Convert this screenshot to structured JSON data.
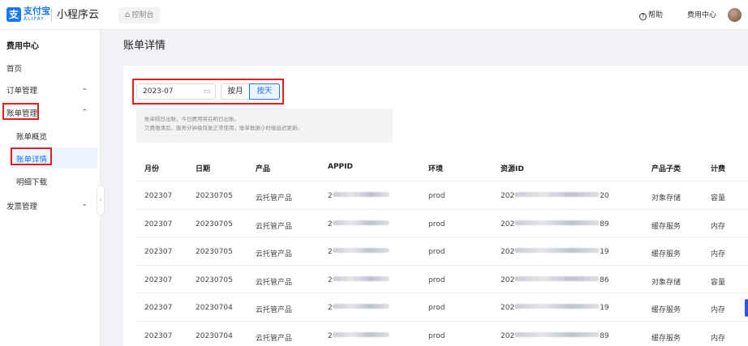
{
  "topbar": {
    "logo_main": "支付宝",
    "logo_sub": "ALIPAY",
    "app_name": "小程序云",
    "console": "控制台",
    "help": "帮助",
    "fee_center": "费用中心"
  },
  "sidebar": {
    "title": "费用中心",
    "items": [
      {
        "label": "首页"
      },
      {
        "label": "订单管理"
      },
      {
        "label": "账单管理"
      },
      {
        "label": "账单概览"
      },
      {
        "label": "账单详情"
      },
      {
        "label": "明细下载"
      },
      {
        "label": "发票管理"
      }
    ]
  },
  "page": {
    "title": "账单详情",
    "date_value": "2023-07",
    "seg_month": "按月",
    "seg_day": "按天",
    "notice_line1": "账单隔日出账，今日费用将在明日出账。",
    "notice_line2": "欠费缴清后，服务分钟级恢复正常使用，账单数据小时级延迟更新。"
  },
  "table": {
    "headers": [
      "月份",
      "日期",
      "产品",
      "APPID",
      "环境",
      "资源ID",
      "产品子类",
      "计费"
    ],
    "rows": [
      {
        "month": "202307",
        "date": "20230705",
        "product": "云托管产品",
        "appid_prefix": "2",
        "env": "prod",
        "rid_prefix": "202",
        "rid_suffix": "20",
        "sub": "对象存储",
        "bill": "容量"
      },
      {
        "month": "202307",
        "date": "20230705",
        "product": "云托管产品",
        "appid_prefix": "2",
        "env": "prod",
        "rid_prefix": "202",
        "rid_suffix": "89",
        "sub": "缓存服务",
        "bill": "内存"
      },
      {
        "month": "202307",
        "date": "20230705",
        "product": "云托管产品",
        "appid_prefix": "2",
        "env": "prod",
        "rid_prefix": "202",
        "rid_suffix": "19",
        "sub": "缓存服务",
        "bill": "内存"
      },
      {
        "month": "202307",
        "date": "20230705",
        "product": "云托管产品",
        "appid_prefix": "2",
        "env": "prod",
        "rid_prefix": "202",
        "rid_suffix": "86",
        "sub": "对象存储",
        "bill": "容量"
      },
      {
        "month": "202307",
        "date": "20230704",
        "product": "云托管产品",
        "appid_prefix": "2",
        "env": "prod",
        "rid_prefix": "202",
        "rid_suffix": "19",
        "sub": "缓存服务",
        "bill": "内存"
      },
      {
        "month": "202307",
        "date": "20230704",
        "product": "云托管产品",
        "appid_prefix": "2",
        "env": "prod",
        "rid_prefix": "202",
        "rid_suffix": "89",
        "sub": "缓存服务",
        "bill": "内存"
      }
    ]
  },
  "colors": {
    "accent": "#1677ff",
    "highlight": "#e02020"
  },
  "icons": [
    "alipay-logo-icon",
    "home-icon",
    "help-icon",
    "calendar-icon",
    "chevron-down-icon",
    "chevron-up-icon",
    "chevron-left-icon"
  ]
}
